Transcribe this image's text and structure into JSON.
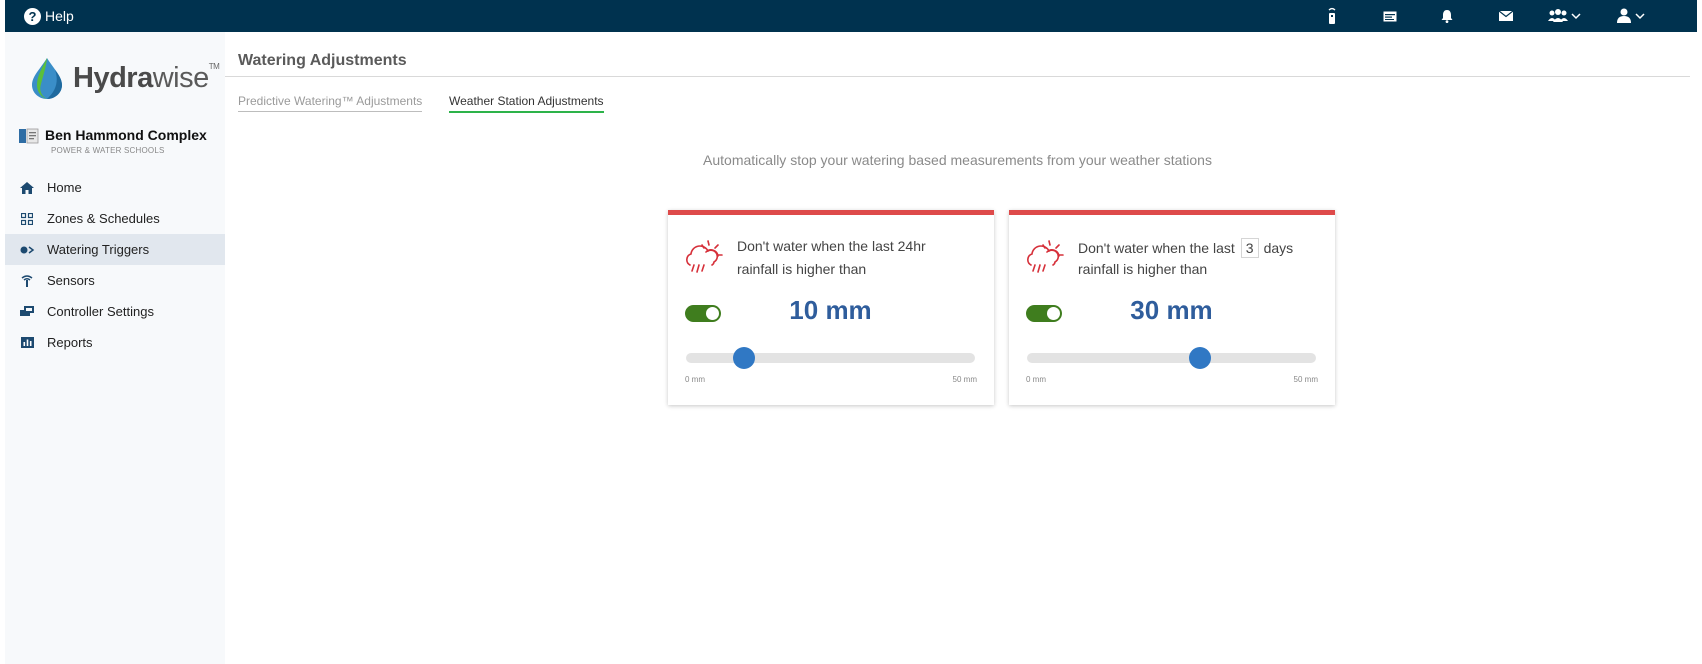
{
  "topbar": {
    "help_label": "Help",
    "icons": [
      "remote-icon",
      "calendar-card-icon",
      "bell-icon",
      "envelope-icon",
      "users-icon",
      "user-icon"
    ]
  },
  "sidebar": {
    "logo": {
      "bold": "Hydra",
      "light": "wise",
      "tm": "TM"
    },
    "site": {
      "name": "Ben Hammond Complex",
      "subtitle": "POWER & WATER SCHOOLS"
    },
    "items": [
      {
        "label": "Home",
        "icon": "home-icon"
      },
      {
        "label": "Zones & Schedules",
        "icon": "zones-grid-icon"
      },
      {
        "label": "Watering Triggers",
        "icon": "trigger-icon",
        "active": true
      },
      {
        "label": "Sensors",
        "icon": "sensor-antenna-icon"
      },
      {
        "label": "Controller Settings",
        "icon": "controller-icon"
      },
      {
        "label": "Reports",
        "icon": "bar-chart-icon"
      }
    ]
  },
  "main": {
    "title": "Watering Adjustments",
    "tabs": [
      {
        "label": "Predictive Watering™ Adjustments",
        "active": false
      },
      {
        "label": "Weather Station Adjustments",
        "active": true
      }
    ],
    "description": "Automatically stop your watering based measurements from your weather stations",
    "cards": [
      {
        "line1": "Don't water when the last 24hr",
        "line2": "rainfall is higher than",
        "enabled": true,
        "value_text": "10 mm",
        "slider_value": 10,
        "slider_min": 0,
        "slider_max": 50,
        "min_label": "0 mm",
        "max_label": "50 mm"
      },
      {
        "line1_pre": "Don't water when the last",
        "days": "3",
        "line1_post": "days",
        "line2": "rainfall is higher than",
        "enabled": true,
        "value_text": "30 mm",
        "slider_value": 30,
        "slider_min": 0,
        "slider_max": 50,
        "min_label": "0 mm",
        "max_label": "50 mm"
      }
    ]
  },
  "colors": {
    "topbar": "#00324f",
    "card_accent": "#de4a4a",
    "toggle_on": "#3f7d1e",
    "value_text": "#2f5d9c",
    "slider_thumb": "#3078c4",
    "tab_underline": "#2db34a"
  }
}
